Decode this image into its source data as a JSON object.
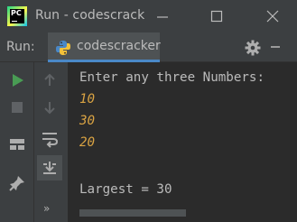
{
  "window": {
    "app_icon_label": "PC",
    "title": "Run - codescrack",
    "controls": [
      "minimize",
      "maximize",
      "close"
    ]
  },
  "run_panel": {
    "label": "Run:",
    "tab_label": "codescracker",
    "tab_icon": "python-icon"
  },
  "toolbar_icons": [
    "rerun-icon",
    "up-arrow-icon",
    "stop-icon",
    "down-arrow-icon",
    "layout-icon",
    "soft-wrap-icon",
    "pin-icon",
    "scroll-to-end-icon",
    "more-icon"
  ],
  "more_label": "»",
  "console": {
    "lines": [
      {
        "text": "Enter any three Numbers:",
        "kind": "prompt"
      },
      {
        "text": "10",
        "kind": "input"
      },
      {
        "text": "30",
        "kind": "input"
      },
      {
        "text": "20",
        "kind": "input"
      },
      {
        "text": "",
        "kind": "prompt"
      },
      {
        "text": "Largest = 30",
        "kind": "prompt"
      }
    ]
  },
  "colors": {
    "background": "#2b2b2b",
    "panel": "#3c3f41",
    "text": "#bbbbbb",
    "input_text": "#d9a343",
    "tab_underline": "#4a88c7",
    "run_green": "#499c54"
  }
}
